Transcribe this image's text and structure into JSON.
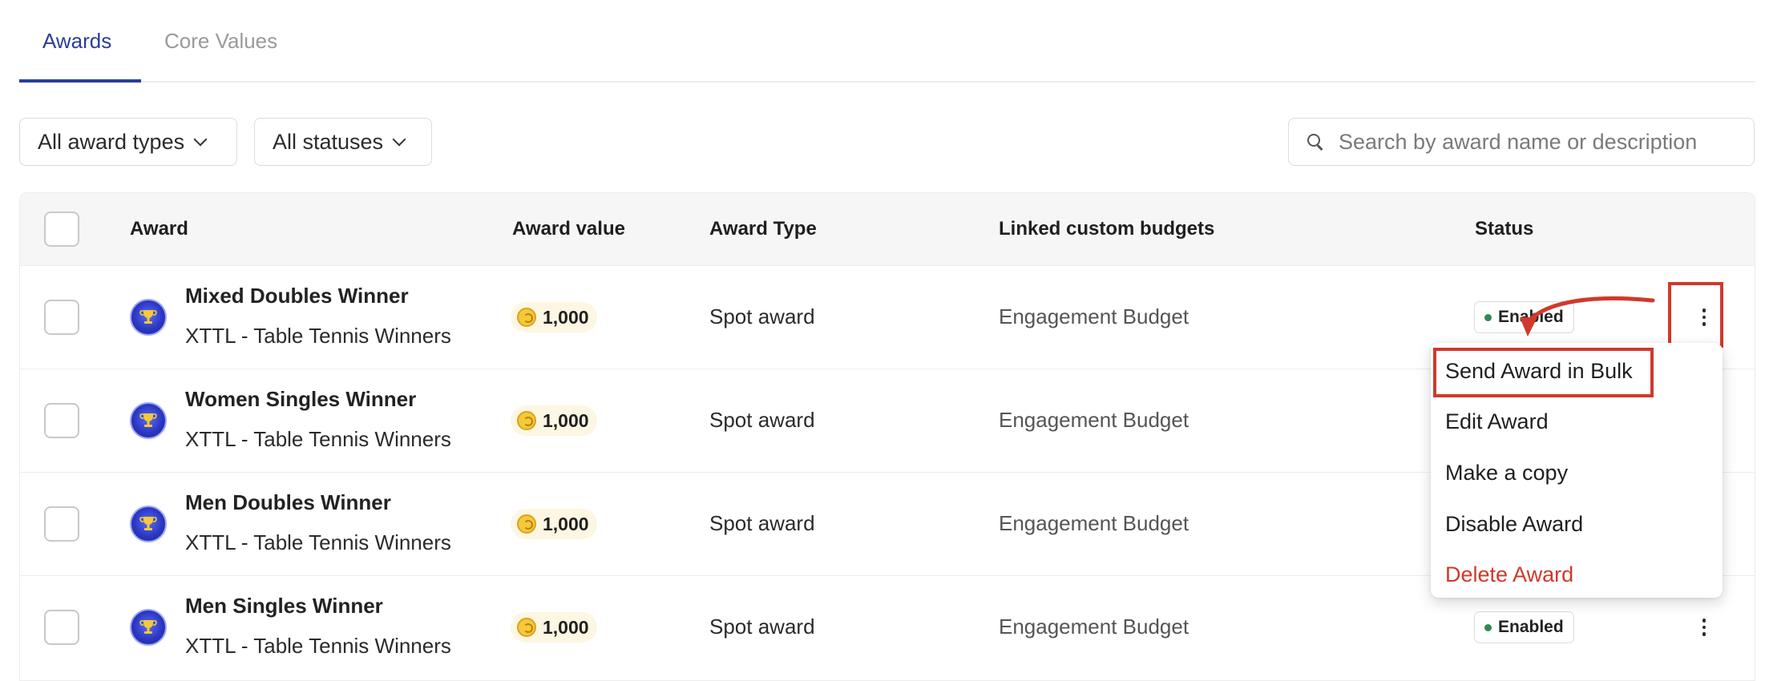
{
  "tabs": [
    {
      "label": "Awards",
      "active": true
    },
    {
      "label": "Core Values",
      "active": false
    }
  ],
  "filters": {
    "award_types": "All award types",
    "statuses": "All statuses",
    "search_placeholder": "Search by award name or description"
  },
  "table": {
    "headers": {
      "award": "Award",
      "award_value": "Award value",
      "award_type": "Award Type",
      "linked_budgets": "Linked custom budgets",
      "status": "Status"
    },
    "rows": [
      {
        "name": "Mixed Doubles Winner",
        "group": "XTTL - Table Tennis Winners",
        "value": "1,000",
        "type": "Spot award",
        "budget": "Engagement Budget",
        "status": "Enabled"
      },
      {
        "name": "Women Singles Winner",
        "group": "XTTL - Table Tennis Winners",
        "value": "1,000",
        "type": "Spot award",
        "budget": "Engagement Budget",
        "status": ""
      },
      {
        "name": "Men Doubles Winner",
        "group": "XTTL - Table Tennis Winners",
        "value": "1,000",
        "type": "Spot award",
        "budget": "Engagement Budget",
        "status": ""
      },
      {
        "name": "Men Singles Winner",
        "group": "XTTL - Table Tennis Winners",
        "value": "1,000",
        "type": "Spot award",
        "budget": "Engagement Budget",
        "status": "Enabled"
      }
    ]
  },
  "row_menu": {
    "items": [
      {
        "label": "Send Award in Bulk",
        "danger": false
      },
      {
        "label": "Edit Award",
        "danger": false
      },
      {
        "label": "Make a copy",
        "danger": false
      },
      {
        "label": "Disable Award",
        "danger": false
      },
      {
        "label": "Delete Award",
        "danger": true
      }
    ]
  },
  "colors": {
    "accent": "#2a3d9c",
    "annotation": "#d0392b",
    "status_enabled": "#2e8a57",
    "danger": "#d0392b",
    "coin": "#f5c93a"
  },
  "icons": {
    "award": "trophy-medal-icon",
    "coin": "coin-icon",
    "search": "search-icon",
    "more": "kebab-menu-icon",
    "dropdown": "chevron-down-icon"
  }
}
